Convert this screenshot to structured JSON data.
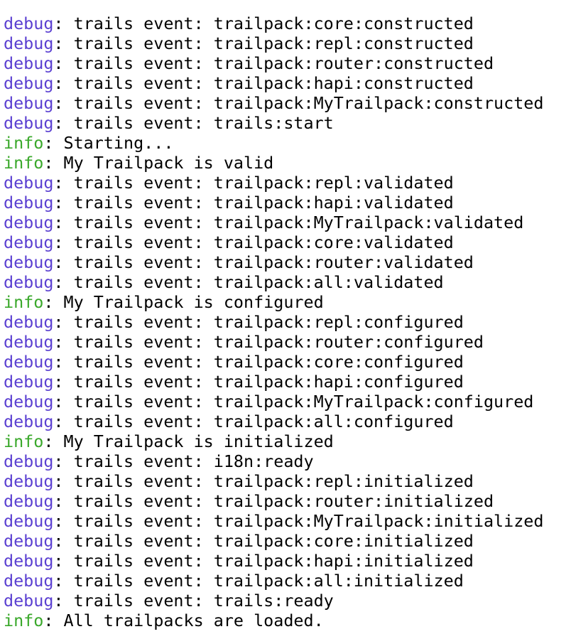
{
  "colors": {
    "debug": "#5a3fd1",
    "info": "#3aa82b",
    "text": "#000000",
    "background": "#ffffff"
  },
  "lines": [
    {
      "level": "debug",
      "message": ": trails event: trailpack:core:constructed"
    },
    {
      "level": "debug",
      "message": ": trails event: trailpack:repl:constructed"
    },
    {
      "level": "debug",
      "message": ": trails event: trailpack:router:constructed"
    },
    {
      "level": "debug",
      "message": ": trails event: trailpack:hapi:constructed"
    },
    {
      "level": "debug",
      "message": ": trails event: trailpack:MyTrailpack:constructed"
    },
    {
      "level": "debug",
      "message": ": trails event: trails:start"
    },
    {
      "level": "info",
      "message": ": Starting..."
    },
    {
      "level": "info",
      "message": ": My Trailpack is valid"
    },
    {
      "level": "debug",
      "message": ": trails event: trailpack:repl:validated"
    },
    {
      "level": "debug",
      "message": ": trails event: trailpack:hapi:validated"
    },
    {
      "level": "debug",
      "message": ": trails event: trailpack:MyTrailpack:validated"
    },
    {
      "level": "debug",
      "message": ": trails event: trailpack:core:validated"
    },
    {
      "level": "debug",
      "message": ": trails event: trailpack:router:validated"
    },
    {
      "level": "debug",
      "message": ": trails event: trailpack:all:validated"
    },
    {
      "level": "info",
      "message": ": My Trailpack is configured"
    },
    {
      "level": "debug",
      "message": ": trails event: trailpack:repl:configured"
    },
    {
      "level": "debug",
      "message": ": trails event: trailpack:router:configured"
    },
    {
      "level": "debug",
      "message": ": trails event: trailpack:core:configured"
    },
    {
      "level": "debug",
      "message": ": trails event: trailpack:hapi:configured"
    },
    {
      "level": "debug",
      "message": ": trails event: trailpack:MyTrailpack:configured"
    },
    {
      "level": "debug",
      "message": ": trails event: trailpack:all:configured"
    },
    {
      "level": "info",
      "message": ": My Trailpack is initialized"
    },
    {
      "level": "debug",
      "message": ": trails event: i18n:ready"
    },
    {
      "level": "debug",
      "message": ": trails event: trailpack:repl:initialized"
    },
    {
      "level": "debug",
      "message": ": trails event: trailpack:router:initialized"
    },
    {
      "level": "debug",
      "message": ": trails event: trailpack:MyTrailpack:initialized"
    },
    {
      "level": "debug",
      "message": ": trails event: trailpack:core:initialized"
    },
    {
      "level": "debug",
      "message": ": trails event: trailpack:hapi:initialized"
    },
    {
      "level": "debug",
      "message": ": trails event: trailpack:all:initialized"
    },
    {
      "level": "debug",
      "message": ": trails event: trails:ready"
    },
    {
      "level": "info",
      "message": ": All trailpacks are loaded."
    }
  ]
}
